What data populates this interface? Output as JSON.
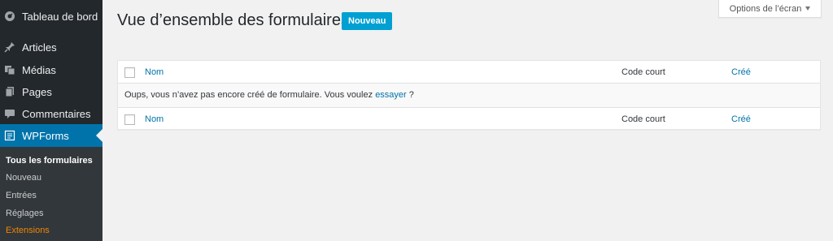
{
  "sidebar": {
    "items": [
      {
        "label": "Tableau de bord",
        "icon": "dashboard-icon"
      },
      {
        "label": "Articles",
        "icon": "pin-icon"
      },
      {
        "label": "Médias",
        "icon": "media-icon"
      },
      {
        "label": "Pages",
        "icon": "pages-icon"
      },
      {
        "label": "Commentaires",
        "icon": "comment-icon"
      },
      {
        "label": "WPForms",
        "icon": "forms-icon"
      }
    ],
    "submenu": [
      {
        "label": "Tous les formulaires"
      },
      {
        "label": "Nouveau"
      },
      {
        "label": "Entrées"
      },
      {
        "label": "Réglages"
      },
      {
        "label": "Extensions"
      }
    ]
  },
  "header": {
    "title": "Vue d’ensemble des formulaires",
    "new_button": "Nouveau",
    "screen_options": "Options de l’écran"
  },
  "table": {
    "columns": {
      "name": "Nom",
      "shortcode": "Code court",
      "created": "Créé"
    },
    "empty_message": "Oups, vous n’avez pas encore créé de formulaire. Vous voulez",
    "empty_link": "essayer",
    "empty_suffix": " ?"
  },
  "colors": {
    "sidebar_bg": "#23282d",
    "submenu_bg": "#32373c",
    "active_bg": "#0073aa",
    "link": "#0073aa",
    "new_button_bg": "#00a0d2",
    "extensions": "#f18500"
  }
}
